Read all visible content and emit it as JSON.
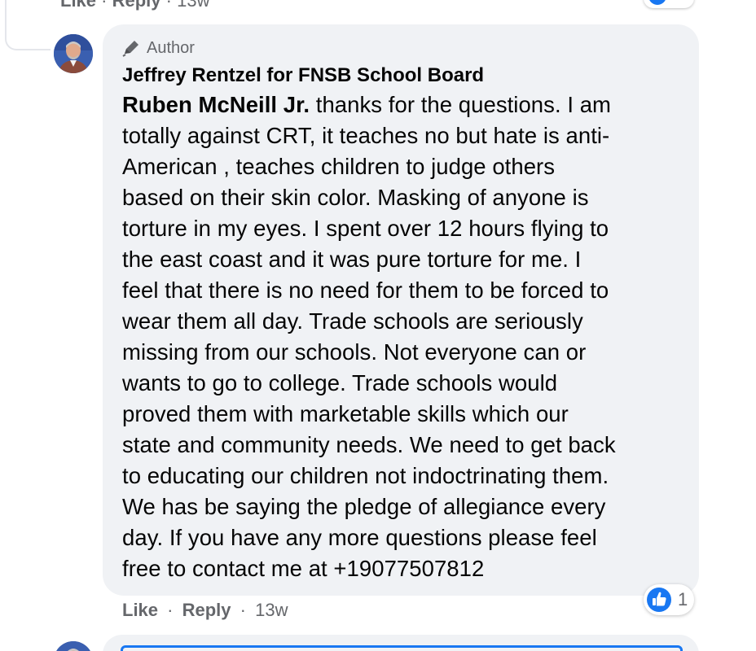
{
  "previous_comment": {
    "like_label": "Like",
    "separator": "·",
    "reply_label": "Reply",
    "time": "13w"
  },
  "comment": {
    "badge_label": "Author",
    "author_name": "Jeffrey Rentzel for FNSB School Board",
    "mention": "Ruben McNeill Jr.",
    "lines": [
      " thanks for the questions. I am",
      "totally against CRT, it teaches no but hate is anti-",
      "American , teaches children to judge others",
      "based on their skin color. Masking of anyone is",
      "torture in my eyes. I spent over 12 hours flying to",
      "the east coast and it was pure torture for me. I",
      "feel that there is no need for them to be forced to",
      "wear them all day. Trade schools are seriously",
      "missing from our schools. Not everyone can or",
      "wants to go to college. Trade schools would",
      "proved them with marketable skills which our",
      "state and community needs. We need to get back",
      "to educating our children not indoctrinating them.",
      "We has be saying the pledge of allegiance every",
      "day. If you have any more questions please feel",
      "free to contact me at +19077507812"
    ],
    "reaction_count": "1",
    "like_label": "Like",
    "separator": "·",
    "reply_label": "Reply",
    "time": "13w"
  },
  "icons": {
    "badge": "pencil-icon",
    "reaction": "thumbs-up-icon"
  },
  "colors": {
    "bubble": "#f0f2f5",
    "secondary_text": "#65676b",
    "like_blue": "#1877f2"
  }
}
